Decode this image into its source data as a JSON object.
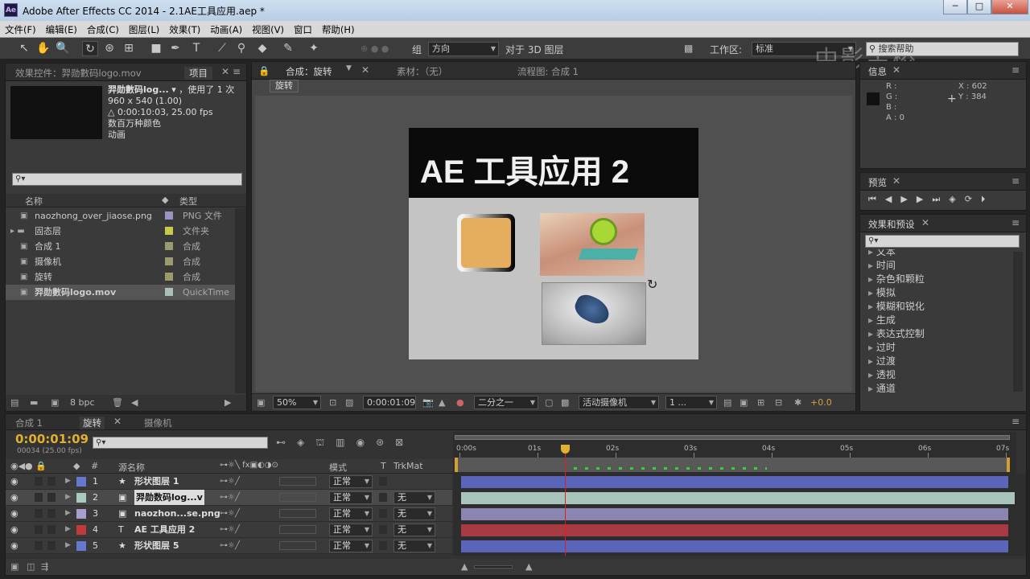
{
  "window": {
    "title": "Adobe After Effects CC 2014 - 2.1AE工具应用.aep *",
    "logo": "Ae",
    "min": "─",
    "max": "□",
    "close": "✕"
  },
  "menu": [
    "文件(F)",
    "编辑(E)",
    "合成(C)",
    "图层(L)",
    "效果(T)",
    "动画(A)",
    "视图(V)",
    "窗口",
    "帮助(H)"
  ],
  "toolbar": {
    "group_label": "组",
    "direction": "方向",
    "align_3d": "对于 3D 图层",
    "workspace_label": "工作区:",
    "workspace": "标准",
    "search_help": "搜索帮助",
    "watermark": "中影金桥"
  },
  "project": {
    "tab_effects": "效果控件：羿勋數码logo.mov",
    "tab_project": "项目",
    "sel_name": "羿勋數码log...",
    "used": "，使用了 1 次",
    "dims": "960 x 540 (1.00)",
    "duration": "△ 0:00:10:03, 25.00 fps",
    "colors": "数百万种颜色",
    "anim": "动画",
    "col_name": "名称",
    "col_type": "类型",
    "bpc": "8 bpc",
    "items": [
      {
        "name": "naozhong_over_jiaose.png",
        "type": "PNG 文件",
        "color": "#9a93c4",
        "icon": "png-file-icon"
      },
      {
        "name": "固态层",
        "type": "文件夹",
        "color": "#c9c94a",
        "icon": "folder-icon"
      },
      {
        "name": "合成 1",
        "type": "合成",
        "color": "#9a9a6e",
        "icon": "comp-icon"
      },
      {
        "name": "摄像机",
        "type": "合成",
        "color": "#9a9a6e",
        "icon": "comp-icon"
      },
      {
        "name": "旋转",
        "type": "合成",
        "color": "#9a9a6e",
        "icon": "comp-icon"
      },
      {
        "name": "羿勋數码logo.mov",
        "type": "QuickTime",
        "color": "#a8c0bc",
        "icon": "quicktime-icon"
      }
    ]
  },
  "viewer": {
    "tab_comp": "合成：旋转",
    "tab_footage": "素材：（无）",
    "tab_flow": "流程图: 合成 1",
    "comp_button": "旋转",
    "headline": "AE 工具应用 2",
    "zoom": "50%",
    "timecode": "0:00:01:09",
    "resolution": "二分之一",
    "camera": "活动摄像机",
    "views": "1 ...",
    "exposure": "+0.0"
  },
  "info": {
    "tab": "信息",
    "r": "R :",
    "g": "G :",
    "b": "B :",
    "a": "A : 0",
    "x": "X : 602",
    "y": "Y : 384"
  },
  "preview": {
    "tab": "预览"
  },
  "effects": {
    "tab": "效果和预设",
    "items": [
      "文本",
      "时间",
      "杂色和颗粒",
      "模拟",
      "模糊和锐化",
      "生成",
      "表达式控制",
      "过时",
      "过渡",
      "透视",
      "通道"
    ]
  },
  "timeline": {
    "tabs": [
      "合成 1",
      "旋转",
      "摄像机"
    ],
    "timecode": "0:00:01:09",
    "frames": "00034 (25.00 fps)",
    "col_num": "#",
    "col_name": "源名称",
    "col_mode": "模式",
    "col_t": "T",
    "col_trk": "TrkMat",
    "ruler": [
      "0:00s",
      "01s",
      "02s",
      "03s",
      "04s",
      "05s",
      "06s",
      "07s"
    ],
    "layers": [
      {
        "num": "1",
        "name": "形状图层 1",
        "mode": "正常",
        "trk": "",
        "color": "#6677cc",
        "bar": "#5865b8",
        "icon": "star-icon"
      },
      {
        "num": "2",
        "name": "羿勋数码log...v",
        "mode": "正常",
        "trk": "无",
        "color": "#a8c8c0",
        "bar": "#a8c4bc",
        "icon": "quicktime-icon"
      },
      {
        "num": "3",
        "name": "naozhon...se.png",
        "mode": "正常",
        "trk": "无",
        "color": "#a8a0cc",
        "bar": "#8a86b0",
        "icon": "png-file-icon"
      },
      {
        "num": "4",
        "name": "AE 工具应用 2",
        "mode": "正常",
        "trk": "无",
        "color": "#c03a3a",
        "bar": "#a83a44",
        "icon": "text-icon"
      },
      {
        "num": "5",
        "name": "形状图层 5",
        "mode": "正常",
        "trk": "无",
        "color": "#6677cc",
        "bar": "#5865b8",
        "icon": "star-icon"
      }
    ]
  }
}
